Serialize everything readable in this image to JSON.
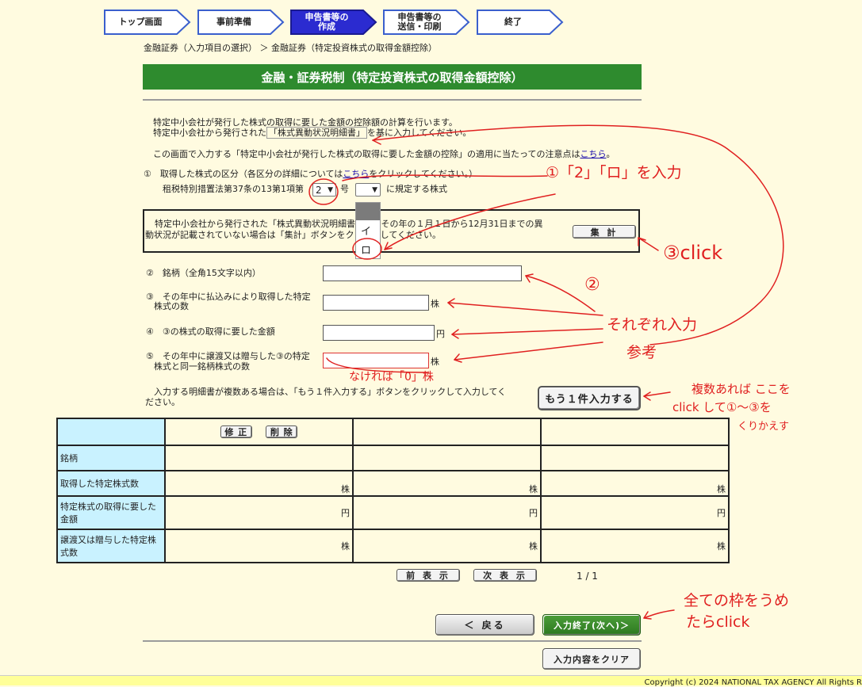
{
  "steps": [
    {
      "label": "トップ画面"
    },
    {
      "label": "事前準備"
    },
    {
      "label": "申告書等の\n作成"
    },
    {
      "label": "申告書等の\n送信・印刷"
    },
    {
      "label": "終了"
    }
  ],
  "breadcrumb": "金融証券（入力項目の選択） ＞ 金融証券（特定投資株式の取得金額控除）",
  "page_title": "金融・証券税制（特定投資株式の取得金額控除）",
  "intro": {
    "line1": "特定中小会社が発行した株式の取得に要した金額の控除額の計算を行います。",
    "line2_pre": "特定中小会社から発行された",
    "line2_boxed": "「株式異動状況明細書」",
    "line2_post": "を基に入力してください。",
    "line3_pre": "この画面で入力する「特定中小会社が発行した株式の取得に要した金額の控除」の適用に当たっての注意点は",
    "line3_link": "こちら",
    "line3_post": "。"
  },
  "section1": {
    "label_pre": "①　取得した株式の区分（各区分の詳細については",
    "label_link": "こちら",
    "label_post": "をクリックしてください。）",
    "law_pre": "租税特別措置法第37条の13第1項第",
    "select1_value": "2",
    "go_label": "号",
    "select2_value": "",
    "law_post": "に規定する株式",
    "dropdown_options": [
      "",
      "イ",
      "ロ"
    ]
  },
  "notice": {
    "line1": "特定中小会社から発行された「株式異動状況明細書」で、その年の１月１日から12月31日までの異",
    "line2": "動状況が記載されていない場合は「集計」ボタンをクリックしてください。",
    "button": "集 計"
  },
  "fields": {
    "f2_label": "②　銘柄（全角15文字以内）",
    "f3_label1": "③　その年中に払込みにより取得した特定",
    "f3_label2": "株式の数",
    "f3_unit": "株",
    "f4_label": "④　③の株式の取得に要した金額",
    "f4_unit": "円",
    "f5_label1": "⑤　その年中に譲渡又は贈与した③の特定",
    "f5_label2": "株式と同一銘柄株式の数",
    "f5_unit": "株"
  },
  "multi": {
    "text1": "入力する明細書が複数ある場合は、「もう１件入力する」ボタンをクリックして入力してく",
    "text2": "ださい。",
    "button": "もう１件入力する"
  },
  "table": {
    "edit": "修 正",
    "delete": "削 除",
    "rows": [
      {
        "label": "銘柄",
        "unit": ""
      },
      {
        "label": "取得した特定株式数",
        "unit": "株"
      },
      {
        "label": "特定株式の取得に要した金額",
        "unit": "円"
      },
      {
        "label": "譲渡又は贈与した特定株式数",
        "unit": "株"
      }
    ]
  },
  "pager": {
    "prev": "前 表 示",
    "next": "次 表 示",
    "status": "1 / 1"
  },
  "nav": {
    "back": "＜ 戻る",
    "next": "入力終了(次へ)＞",
    "clear": "入力内容をクリア"
  },
  "footer": "Copyright (c) 2024 NATIONAL TAX AGENCY All Rights R",
  "annotations": {
    "a1": "①「2」「ロ」を入力",
    "a3": "③click",
    "a2": "②",
    "a2b": "それぞれ入力",
    "a2c": "参考",
    "a5": "なければ「0」株",
    "a6a": "複数あれば ここを",
    "a6b": "click して①～③を",
    "a6c": "くりかえす",
    "a7a": "全ての枠をうめ",
    "a7b": "たらclick"
  },
  "colors": {
    "title_green": "#2e8b2e",
    "active_step": "#2b2bd0",
    "annotation_red": "#e02020",
    "table_header": "#c9f2ff"
  }
}
